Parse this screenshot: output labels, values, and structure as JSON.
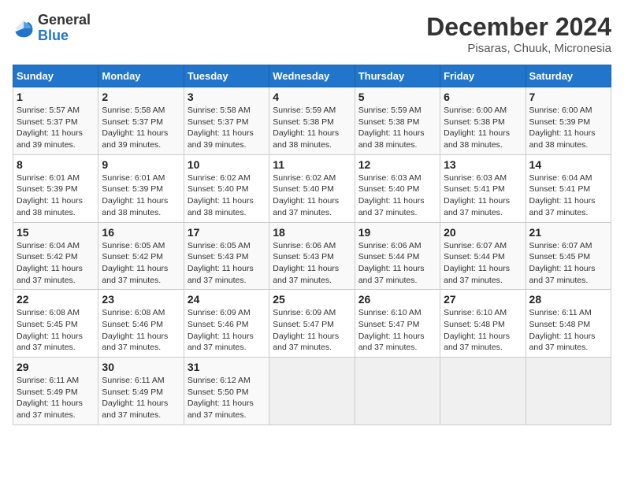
{
  "header": {
    "logo_general": "General",
    "logo_blue": "Blue",
    "title": "December 2024",
    "subtitle": "Pisaras, Chuuk, Micronesia"
  },
  "weekdays": [
    "Sunday",
    "Monday",
    "Tuesday",
    "Wednesday",
    "Thursday",
    "Friday",
    "Saturday"
  ],
  "weeks": [
    [
      {
        "day": "1",
        "sunrise": "5:57 AM",
        "sunset": "5:37 PM",
        "daylight": "11 hours and 39 minutes."
      },
      {
        "day": "2",
        "sunrise": "5:58 AM",
        "sunset": "5:37 PM",
        "daylight": "11 hours and 39 minutes."
      },
      {
        "day": "3",
        "sunrise": "5:58 AM",
        "sunset": "5:37 PM",
        "daylight": "11 hours and 39 minutes."
      },
      {
        "day": "4",
        "sunrise": "5:59 AM",
        "sunset": "5:38 PM",
        "daylight": "11 hours and 38 minutes."
      },
      {
        "day": "5",
        "sunrise": "5:59 AM",
        "sunset": "5:38 PM",
        "daylight": "11 hours and 38 minutes."
      },
      {
        "day": "6",
        "sunrise": "6:00 AM",
        "sunset": "5:38 PM",
        "daylight": "11 hours and 38 minutes."
      },
      {
        "day": "7",
        "sunrise": "6:00 AM",
        "sunset": "5:39 PM",
        "daylight": "11 hours and 38 minutes."
      }
    ],
    [
      {
        "day": "8",
        "sunrise": "6:01 AM",
        "sunset": "5:39 PM",
        "daylight": "11 hours and 38 minutes."
      },
      {
        "day": "9",
        "sunrise": "6:01 AM",
        "sunset": "5:39 PM",
        "daylight": "11 hours and 38 minutes."
      },
      {
        "day": "10",
        "sunrise": "6:02 AM",
        "sunset": "5:40 PM",
        "daylight": "11 hours and 38 minutes."
      },
      {
        "day": "11",
        "sunrise": "6:02 AM",
        "sunset": "5:40 PM",
        "daylight": "11 hours and 37 minutes."
      },
      {
        "day": "12",
        "sunrise": "6:03 AM",
        "sunset": "5:40 PM",
        "daylight": "11 hours and 37 minutes."
      },
      {
        "day": "13",
        "sunrise": "6:03 AM",
        "sunset": "5:41 PM",
        "daylight": "11 hours and 37 minutes."
      },
      {
        "day": "14",
        "sunrise": "6:04 AM",
        "sunset": "5:41 PM",
        "daylight": "11 hours and 37 minutes."
      }
    ],
    [
      {
        "day": "15",
        "sunrise": "6:04 AM",
        "sunset": "5:42 PM",
        "daylight": "11 hours and 37 minutes."
      },
      {
        "day": "16",
        "sunrise": "6:05 AM",
        "sunset": "5:42 PM",
        "daylight": "11 hours and 37 minutes."
      },
      {
        "day": "17",
        "sunrise": "6:05 AM",
        "sunset": "5:43 PM",
        "daylight": "11 hours and 37 minutes."
      },
      {
        "day": "18",
        "sunrise": "6:06 AM",
        "sunset": "5:43 PM",
        "daylight": "11 hours and 37 minutes."
      },
      {
        "day": "19",
        "sunrise": "6:06 AM",
        "sunset": "5:44 PM",
        "daylight": "11 hours and 37 minutes."
      },
      {
        "day": "20",
        "sunrise": "6:07 AM",
        "sunset": "5:44 PM",
        "daylight": "11 hours and 37 minutes."
      },
      {
        "day": "21",
        "sunrise": "6:07 AM",
        "sunset": "5:45 PM",
        "daylight": "11 hours and 37 minutes."
      }
    ],
    [
      {
        "day": "22",
        "sunrise": "6:08 AM",
        "sunset": "5:45 PM",
        "daylight": "11 hours and 37 minutes."
      },
      {
        "day": "23",
        "sunrise": "6:08 AM",
        "sunset": "5:46 PM",
        "daylight": "11 hours and 37 minutes."
      },
      {
        "day": "24",
        "sunrise": "6:09 AM",
        "sunset": "5:46 PM",
        "daylight": "11 hours and 37 minutes."
      },
      {
        "day": "25",
        "sunrise": "6:09 AM",
        "sunset": "5:47 PM",
        "daylight": "11 hours and 37 minutes."
      },
      {
        "day": "26",
        "sunrise": "6:10 AM",
        "sunset": "5:47 PM",
        "daylight": "11 hours and 37 minutes."
      },
      {
        "day": "27",
        "sunrise": "6:10 AM",
        "sunset": "5:48 PM",
        "daylight": "11 hours and 37 minutes."
      },
      {
        "day": "28",
        "sunrise": "6:11 AM",
        "sunset": "5:48 PM",
        "daylight": "11 hours and 37 minutes."
      }
    ],
    [
      {
        "day": "29",
        "sunrise": "6:11 AM",
        "sunset": "5:49 PM",
        "daylight": "11 hours and 37 minutes."
      },
      {
        "day": "30",
        "sunrise": "6:11 AM",
        "sunset": "5:49 PM",
        "daylight": "11 hours and 37 minutes."
      },
      {
        "day": "31",
        "sunrise": "6:12 AM",
        "sunset": "5:50 PM",
        "daylight": "11 hours and 37 minutes."
      },
      null,
      null,
      null,
      null
    ]
  ]
}
